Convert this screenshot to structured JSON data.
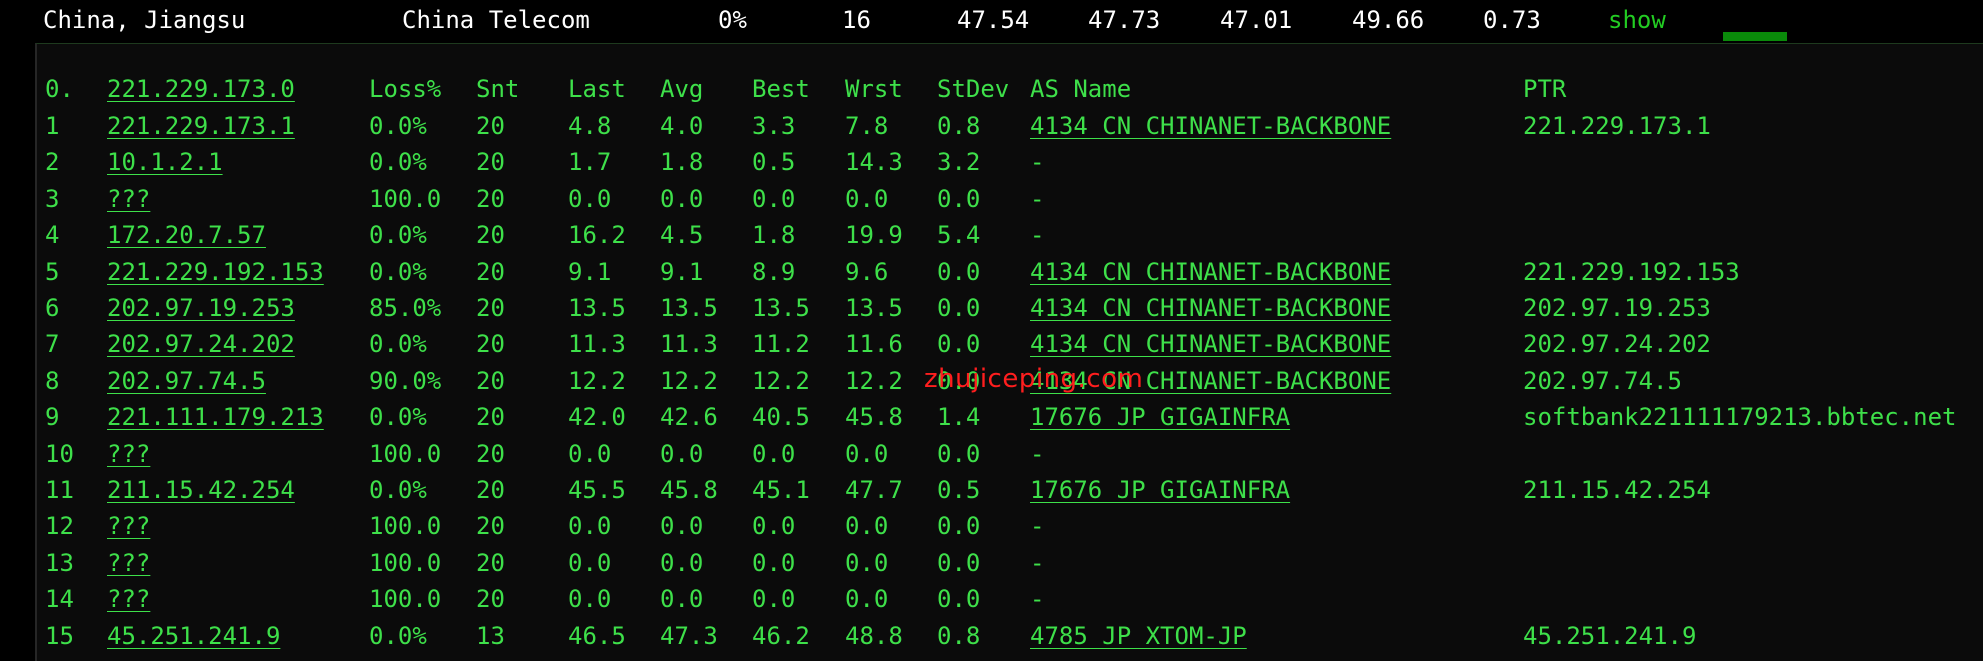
{
  "summary": {
    "location": "China, Jiangsu",
    "isp": "China Telecom",
    "loss": "0%",
    "sent": "16",
    "last": "47.54",
    "avg": "47.73",
    "best": "47.01",
    "worst": "49.66",
    "stdev": "0.73",
    "show_label": "show"
  },
  "header": {
    "hop": "0.",
    "host": "221.229.173.0",
    "loss": "Loss%",
    "snt": "Snt",
    "last": "Last",
    "avg": "Avg",
    "best": "Best",
    "wrst": "Wrst",
    "stdev": "StDev",
    "as_name": "AS Name",
    "ptr": "PTR"
  },
  "rows": [
    {
      "hop": "1",
      "host": "221.229.173.1",
      "loss": "0.0%",
      "snt": "20",
      "last": "4.8",
      "avg": "4.0",
      "best": "3.3",
      "wrst": "7.8",
      "stdev": "0.8",
      "as_name": "4134  CN CHINANET-BACKBONE",
      "ptr": "221.229.173.1"
    },
    {
      "hop": "2",
      "host": "10.1.2.1",
      "loss": "0.0%",
      "snt": "20",
      "last": "1.7",
      "avg": "1.8",
      "best": "0.5",
      "wrst": "14.3",
      "stdev": "3.2",
      "as_name": "-",
      "ptr": ""
    },
    {
      "hop": "3",
      "host": "???",
      "loss": "100.0",
      "snt": "20",
      "last": "0.0",
      "avg": "0.0",
      "best": "0.0",
      "wrst": "0.0",
      "stdev": "0.0",
      "as_name": "-",
      "ptr": ""
    },
    {
      "hop": "4",
      "host": "172.20.7.57",
      "loss": "0.0%",
      "snt": "20",
      "last": "16.2",
      "avg": "4.5",
      "best": "1.8",
      "wrst": "19.9",
      "stdev": "5.4",
      "as_name": "-",
      "ptr": ""
    },
    {
      "hop": "5",
      "host": "221.229.192.153",
      "loss": "0.0%",
      "snt": "20",
      "last": "9.1",
      "avg": "9.1",
      "best": "8.9",
      "wrst": "9.6",
      "stdev": "0.0",
      "as_name": "4134  CN CHINANET-BACKBONE",
      "ptr": "221.229.192.153"
    },
    {
      "hop": "6",
      "host": "202.97.19.253",
      "loss": "85.0%",
      "snt": "20",
      "last": "13.5",
      "avg": "13.5",
      "best": "13.5",
      "wrst": "13.5",
      "stdev": "0.0",
      "as_name": "4134  CN CHINANET-BACKBONE",
      "ptr": "202.97.19.253"
    },
    {
      "hop": "7",
      "host": "202.97.24.202",
      "loss": "0.0%",
      "snt": "20",
      "last": "11.3",
      "avg": "11.3",
      "best": "11.2",
      "wrst": "11.6",
      "stdev": "0.0",
      "as_name": "4134  CN CHINANET-BACKBONE",
      "ptr": "202.97.24.202"
    },
    {
      "hop": "8",
      "host": "202.97.74.5",
      "loss": "90.0%",
      "snt": "20",
      "last": "12.2",
      "avg": "12.2",
      "best": "12.2",
      "wrst": "12.2",
      "stdev": "0.0",
      "as_name": "4134  CN CHINANET-BACKBONE",
      "ptr": "202.97.74.5"
    },
    {
      "hop": "9",
      "host": "221.111.179.213",
      "loss": "0.0%",
      "snt": "20",
      "last": "42.0",
      "avg": "42.6",
      "best": "40.5",
      "wrst": "45.8",
      "stdev": "1.4",
      "as_name": "17676  JP GIGAINFRA",
      "ptr": "softbank221111179213.bbtec.net"
    },
    {
      "hop": "10",
      "host": "???",
      "loss": "100.0",
      "snt": "20",
      "last": "0.0",
      "avg": "0.0",
      "best": "0.0",
      "wrst": "0.0",
      "stdev": "0.0",
      "as_name": "-",
      "ptr": ""
    },
    {
      "hop": "11",
      "host": "211.15.42.254",
      "loss": "0.0%",
      "snt": "20",
      "last": "45.5",
      "avg": "45.8",
      "best": "45.1",
      "wrst": "47.7",
      "stdev": "0.5",
      "as_name": "17676  JP GIGAINFRA",
      "ptr": "211.15.42.254"
    },
    {
      "hop": "12",
      "host": "???",
      "loss": "100.0",
      "snt": "20",
      "last": "0.0",
      "avg": "0.0",
      "best": "0.0",
      "wrst": "0.0",
      "stdev": "0.0",
      "as_name": "-",
      "ptr": ""
    },
    {
      "hop": "13",
      "host": "???",
      "loss": "100.0",
      "snt": "20",
      "last": "0.0",
      "avg": "0.0",
      "best": "0.0",
      "wrst": "0.0",
      "stdev": "0.0",
      "as_name": "-",
      "ptr": ""
    },
    {
      "hop": "14",
      "host": "???",
      "loss": "100.0",
      "snt": "20",
      "last": "0.0",
      "avg": "0.0",
      "best": "0.0",
      "wrst": "0.0",
      "stdev": "0.0",
      "as_name": "-",
      "ptr": ""
    },
    {
      "hop": "15",
      "host": "45.251.241.9",
      "loss": "0.0%",
      "snt": "13",
      "last": "46.5",
      "avg": "47.3",
      "best": "46.2",
      "wrst": "48.8",
      "stdev": "0.8",
      "as_name": "4785  JP XTOM-JP",
      "ptr": "45.251.241.9"
    }
  ],
  "watermark": "zhujiceping.com"
}
